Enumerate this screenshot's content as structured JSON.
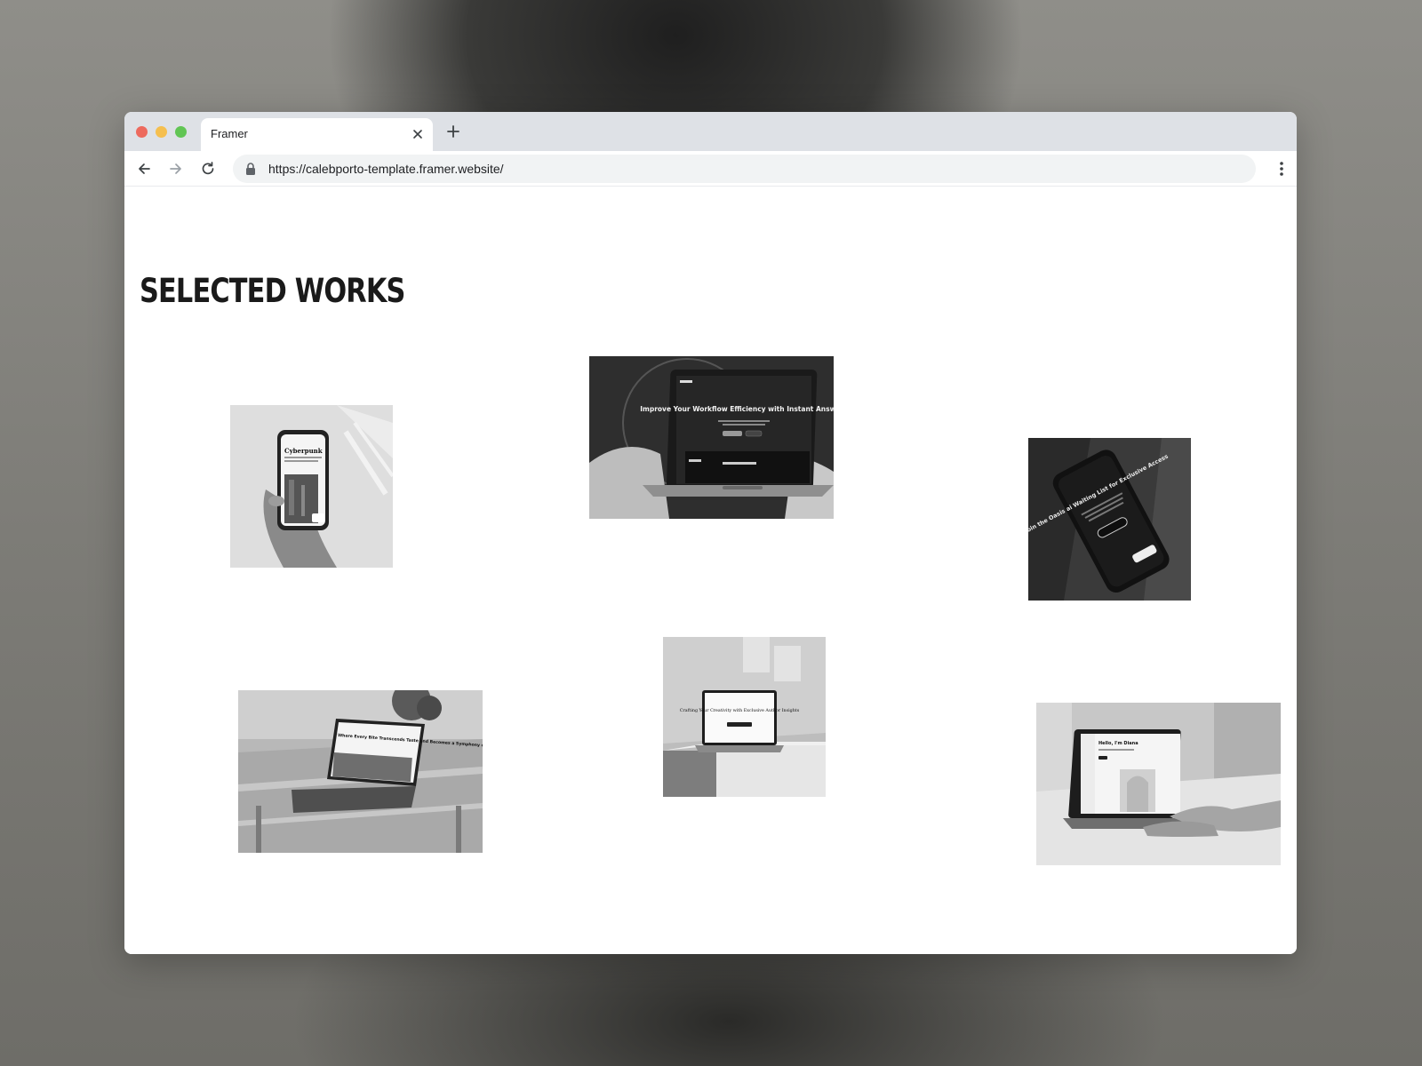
{
  "browser": {
    "tab_title": "Framer",
    "url": "https://calebporto-template.framer.website/"
  },
  "page": {
    "heading": "SELECTED WORKS"
  },
  "works": [
    {
      "screen_title": "Cyberpunk",
      "device": "phone"
    },
    {
      "screen_title": "Improve Your Workflow Efficiency with Instant Answers",
      "device": "laptop"
    },
    {
      "screen_title": "Join the Oasis ai Waiting List for Exclusive Access",
      "device": "phone"
    },
    {
      "screen_title": "Where Every Bite Transcends Taste and Becomes a Symphony of Luxury",
      "device": "laptop"
    },
    {
      "screen_title": "Crafting Your Creativity with Exclusive Author Insights",
      "device": "laptop"
    },
    {
      "screen_title": "Hello, I'm Diana",
      "device": "laptop"
    }
  ]
}
